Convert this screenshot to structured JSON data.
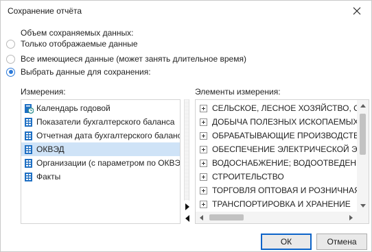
{
  "window": {
    "title": "Сохранение отчёта"
  },
  "options": {
    "group_label": "Объем сохраняемых данных:",
    "items": [
      {
        "label": "Только отображаемые данные",
        "checked": false
      },
      {
        "label": "Все имеющиеся данные (может занять длительное время)",
        "checked": false
      },
      {
        "label": "Выбрать данные для сохранения:",
        "checked": true
      }
    ]
  },
  "dimensions": {
    "label": "Измерения:",
    "items": [
      {
        "label": "Календарь годовой",
        "icon": "calendar-dimension-icon",
        "selected": false
      },
      {
        "label": "Показатели бухгалтерского баланса",
        "icon": "dimension-table-icon",
        "selected": false
      },
      {
        "label": "Отчетная дата бухгалтерского баланса",
        "icon": "dimension-table-icon",
        "selected": false
      },
      {
        "label": "ОКВЭД",
        "icon": "dimension-table-icon",
        "selected": true
      },
      {
        "label": "Организации (с параметром по ОКВЭД)",
        "icon": "dimension-table-icon",
        "selected": false
      },
      {
        "label": "Факты",
        "icon": "dimension-table-icon",
        "selected": false
      }
    ]
  },
  "elements": {
    "label": "Элементы измерения:",
    "items": [
      "СЕЛЬСКОЕ, ЛЕСНОЕ ХОЗЯЙСТВО, ОХОТА",
      "ДОБЫЧА ПОЛЕЗНЫХ ИСКОПАЕМЫХ",
      "ОБРАБАТЫВАЮЩИЕ ПРОИЗВОДСТВА",
      "ОБЕСПЕЧЕНИЕ ЭЛЕКТРИЧЕСКОЙ ЭНЕРГИЕЙ",
      "ВОДОСНАБЖЕНИЕ; ВОДООТВЕДЕНИЕ, С",
      "СТРОИТЕЛЬСТВО",
      "ТОРГОВЛЯ ОПТОВАЯ И РОЗНИЧНАЯ; РЕМ",
      "ТРАНСПОРТИРОВКА И ХРАНЕНИЕ"
    ]
  },
  "buttons": {
    "ok": "ОК",
    "cancel": "Отмена"
  },
  "colors": {
    "accent": "#2b79d9",
    "selection": "#cfe3f7",
    "icon_blue": "#1e6fc3",
    "icon_teal": "#2a8c8c"
  }
}
